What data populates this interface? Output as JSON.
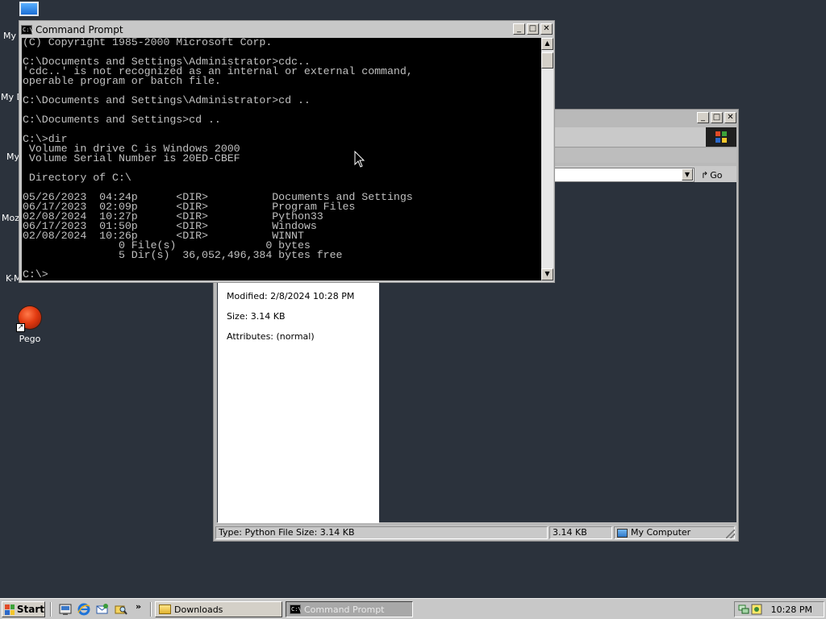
{
  "desktop": {
    "icons": [
      {
        "label": "My"
      },
      {
        "label": "My D"
      },
      {
        "label": "My"
      },
      {
        "label": "Moz"
      },
      {
        "label": "K-M"
      },
      {
        "label": "Pego"
      }
    ]
  },
  "explorer": {
    "info": {
      "modified": "Modified: 2/8/2024 10:28 PM",
      "size": "Size: 3.14 KB",
      "attributes": "Attributes: (normal)"
    },
    "go_label": "Go",
    "status": {
      "left": "Type: Python File Size: 3.14 KB",
      "size": "3.14 KB",
      "zone": "My Computer"
    }
  },
  "cmd": {
    "title": "Command Prompt",
    "lines": [
      "(C) Copyright 1985-2000 Microsoft Corp.",
      "",
      "C:\\Documents and Settings\\Administrator>cdc..",
      "'cdc..' is not recognized as an internal or external command,",
      "operable program or batch file.",
      "",
      "C:\\Documents and Settings\\Administrator>cd ..",
      "",
      "C:\\Documents and Settings>cd ..",
      "",
      "C:\\>dir",
      " Volume in drive C is Windows 2000",
      " Volume Serial Number is 20ED-CBEF",
      "",
      " Directory of C:\\",
      "",
      "05/26/2023  04:24p      <DIR>          Documents and Settings",
      "06/17/2023  02:09p      <DIR>          Program Files",
      "02/08/2024  10:27p      <DIR>          Python33",
      "06/17/2023  01:50p      <DIR>          Windows",
      "02/08/2024  10:26p      <DIR>          WINNT",
      "               0 File(s)              0 bytes",
      "               5 Dir(s)  36,052,496,384 bytes free",
      "",
      "C:\\>"
    ]
  },
  "taskbar": {
    "start_label": "Start",
    "more": "»",
    "tasks": [
      {
        "label": "Downloads",
        "active": false
      },
      {
        "label": "Command Prompt",
        "active": true
      }
    ],
    "clock": "10:28 PM"
  }
}
